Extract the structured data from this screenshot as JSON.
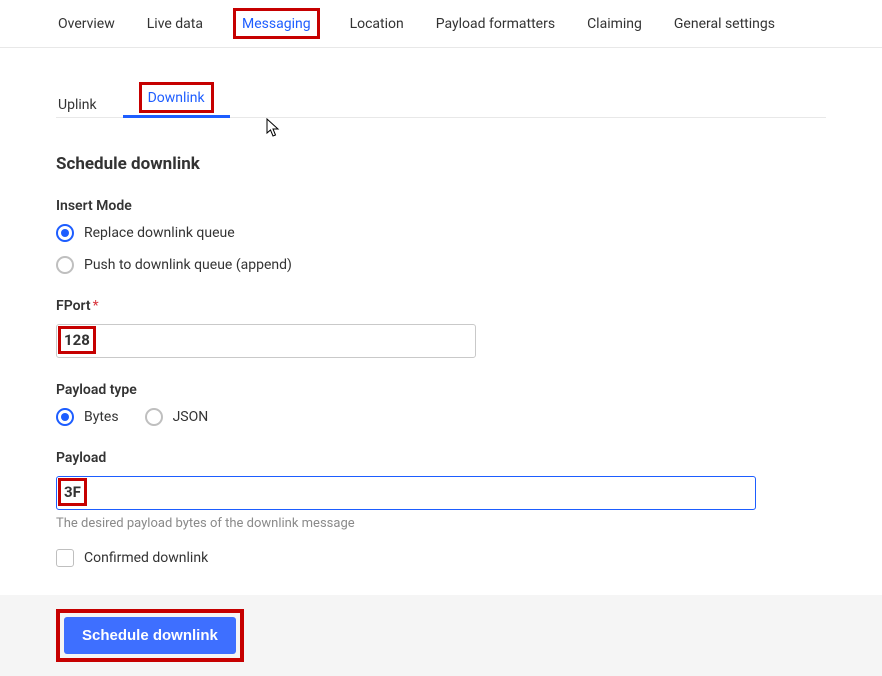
{
  "topTabs": {
    "overview": "Overview",
    "liveData": "Live data",
    "messaging": "Messaging",
    "location": "Location",
    "payloadFormatters": "Payload formatters",
    "claiming": "Claiming",
    "generalSettings": "General settings"
  },
  "subTabs": {
    "uplink": "Uplink",
    "downlink": "Downlink"
  },
  "page": {
    "title": "Schedule downlink"
  },
  "insertMode": {
    "label": "Insert Mode",
    "replace": "Replace downlink queue",
    "append": "Push to downlink queue (append)"
  },
  "fport": {
    "label": "FPort",
    "value": "128"
  },
  "payloadType": {
    "label": "Payload type",
    "bytes": "Bytes",
    "json": "JSON"
  },
  "payload": {
    "label": "Payload",
    "value": "3F",
    "help": "The desired payload bytes of the downlink message"
  },
  "confirmed": {
    "label": "Confirmed downlink"
  },
  "actions": {
    "schedule": "Schedule downlink"
  }
}
